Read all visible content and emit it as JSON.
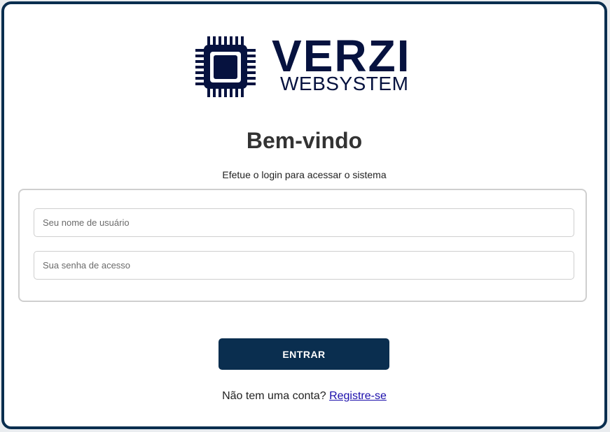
{
  "logo": {
    "brand": "VERZI",
    "tagline": "WEBSYSTEM",
    "icon": "chip-icon",
    "color": "#06123f"
  },
  "heading": {
    "title": "Bem-vindo",
    "subtitle": "Efetue o login para acessar o sistema"
  },
  "form": {
    "username": {
      "value": "",
      "placeholder": "Seu nome de usuário"
    },
    "password": {
      "value": "",
      "placeholder": "Sua senha de acesso"
    },
    "submit_label": "ENTRAR"
  },
  "footer": {
    "prompt": "Não tem uma conta?",
    "register_link": "Registre-se"
  },
  "colors": {
    "accent": "#0a2e4f",
    "link": "#1a0dab"
  }
}
